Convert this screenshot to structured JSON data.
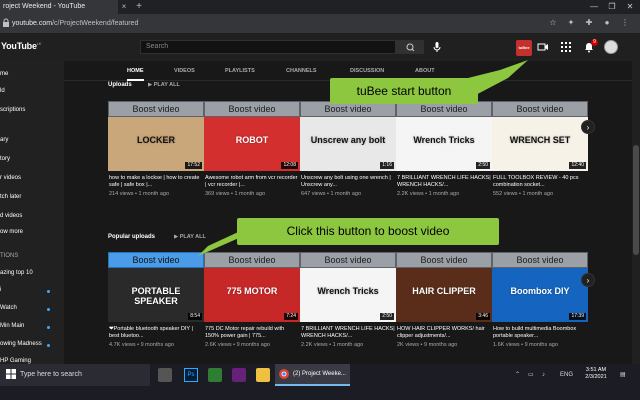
{
  "browser": {
    "tab_title": "roject Weekend - YouTube",
    "tab_close": "×",
    "new_tab": "+",
    "url_host": "youtube.com",
    "url_path": "/c/ProjectWeekend/featured"
  },
  "header": {
    "logo": "YouTube",
    "logo_region": "LK",
    "search_placeholder": "Search",
    "tubee_label": "tuBee",
    "notif_count": "9"
  },
  "sidebar": {
    "items": [
      {
        "label": "me"
      },
      {
        "label": "ld"
      },
      {
        "label": "scriptions"
      },
      {
        "label": "ary"
      },
      {
        "label": "tory"
      },
      {
        "label": "r videos"
      },
      {
        "label": "tch later"
      },
      {
        "label": "d videos"
      },
      {
        "label": "ow more"
      },
      {
        "label": "TIONS"
      },
      {
        "label": "azing top 10"
      },
      {
        "label": "i"
      },
      {
        "label": "Watch"
      },
      {
        "label": "Min Main"
      },
      {
        "label": "owing Madness"
      },
      {
        "label": "HP Gaming"
      }
    ]
  },
  "channel_tabs": [
    {
      "label": "HOME"
    },
    {
      "label": "VIDEOS"
    },
    {
      "label": "PLAYLISTS"
    },
    {
      "label": "CHANNELS"
    },
    {
      "label": "DISCUSSION"
    },
    {
      "label": "ABOUT"
    }
  ],
  "sections": {
    "uploads": {
      "title": "Uploads",
      "play_all": "PLAY ALL"
    },
    "popular": {
      "title": "Popular uploads",
      "play_all": "PLAY ALL"
    }
  },
  "boost_label": "Boost video",
  "uploads_videos": [
    {
      "title": "how to make a lockse | how to create safe | safe box |...",
      "meta": "214 views • 1 month ago",
      "duration": "17:52",
      "thumb_text": "LOCKER",
      "thumb_bg": "#c9a77a"
    },
    {
      "title": "Awesome robot arm from vcr recorder | vcr recorder |...",
      "meta": "369 views • 1 month ago",
      "duration": "12:08",
      "thumb_text": "ROBOT",
      "thumb_bg": "#d32f2f"
    },
    {
      "title": "Unscrew any bolt using one wrench | Unscrew any...",
      "meta": "647 views • 1 month ago",
      "duration": "1:16",
      "thumb_text": "Unscrew any bolt",
      "thumb_bg": "#e8e8e8"
    },
    {
      "title": "7 BRILLIANT WRENCH LIFE HACKS| WRENCH HACKS/...",
      "meta": "2.2K views • 1 month ago",
      "duration": "2:50",
      "thumb_text": "Wrench Tricks",
      "thumb_bg": "#f5f5f5"
    },
    {
      "title": "FULL TOOLBOX REVIEW - 40 pcs combination socket...",
      "meta": "552 views • 1 month ago",
      "duration": "12:40",
      "thumb_text": "WRENCH SET",
      "thumb_bg": "#f7f2e8"
    }
  ],
  "popular_videos": [
    {
      "title": "❤Portable bluetooth speaker DIY | best bluetoo...",
      "meta": "4.7K views • 9 months ago",
      "duration": "8:54",
      "thumb_text": "PORTABLE SPEAKER",
      "thumb_bg": "#2a2a2a"
    },
    {
      "title": "775 DC Motor repair rebuild with 150% power gain | 775...",
      "meta": "2.6K views • 9 months ago",
      "duration": "7:24",
      "thumb_text": "775 MOTOR",
      "thumb_bg": "#c62828"
    },
    {
      "title": "7 BRILLIANT WRENCH LIFE HACKS| WRENCH HACKS/...",
      "meta": "2.2K views • 1 month ago",
      "duration": "2:50",
      "thumb_text": "Wrench Tricks",
      "thumb_bg": "#f5f5f5"
    },
    {
      "title": "HOW HAIR CLIPPER WORKS/ hair clipper adjustments/...",
      "meta": "2K views • 9 months ago",
      "duration": "3:46",
      "thumb_text": "HAIR CLIPPER",
      "thumb_bg": "#5a2d1a"
    },
    {
      "title": "How to build multimedia Boombox portable speaker...",
      "meta": "1.6K views • 9 months ago",
      "duration": "17:39",
      "thumb_text": "Boombox DIY",
      "thumb_bg": "#1565c0"
    }
  ],
  "callouts": {
    "tubee": "tuBee start button",
    "boost": "Click this button to boost video"
  },
  "taskbar": {
    "search": "Type here to search",
    "active_app": "(2) Project Weeke...",
    "lang": "ENG",
    "time": "3:51 AM",
    "date": "2/3/2021"
  },
  "colors": {
    "callout_green": "#8dc63f",
    "boost_gray": "#9aa0a6",
    "boost_blue": "#4a9be8",
    "yt_red": "#c4302b"
  }
}
